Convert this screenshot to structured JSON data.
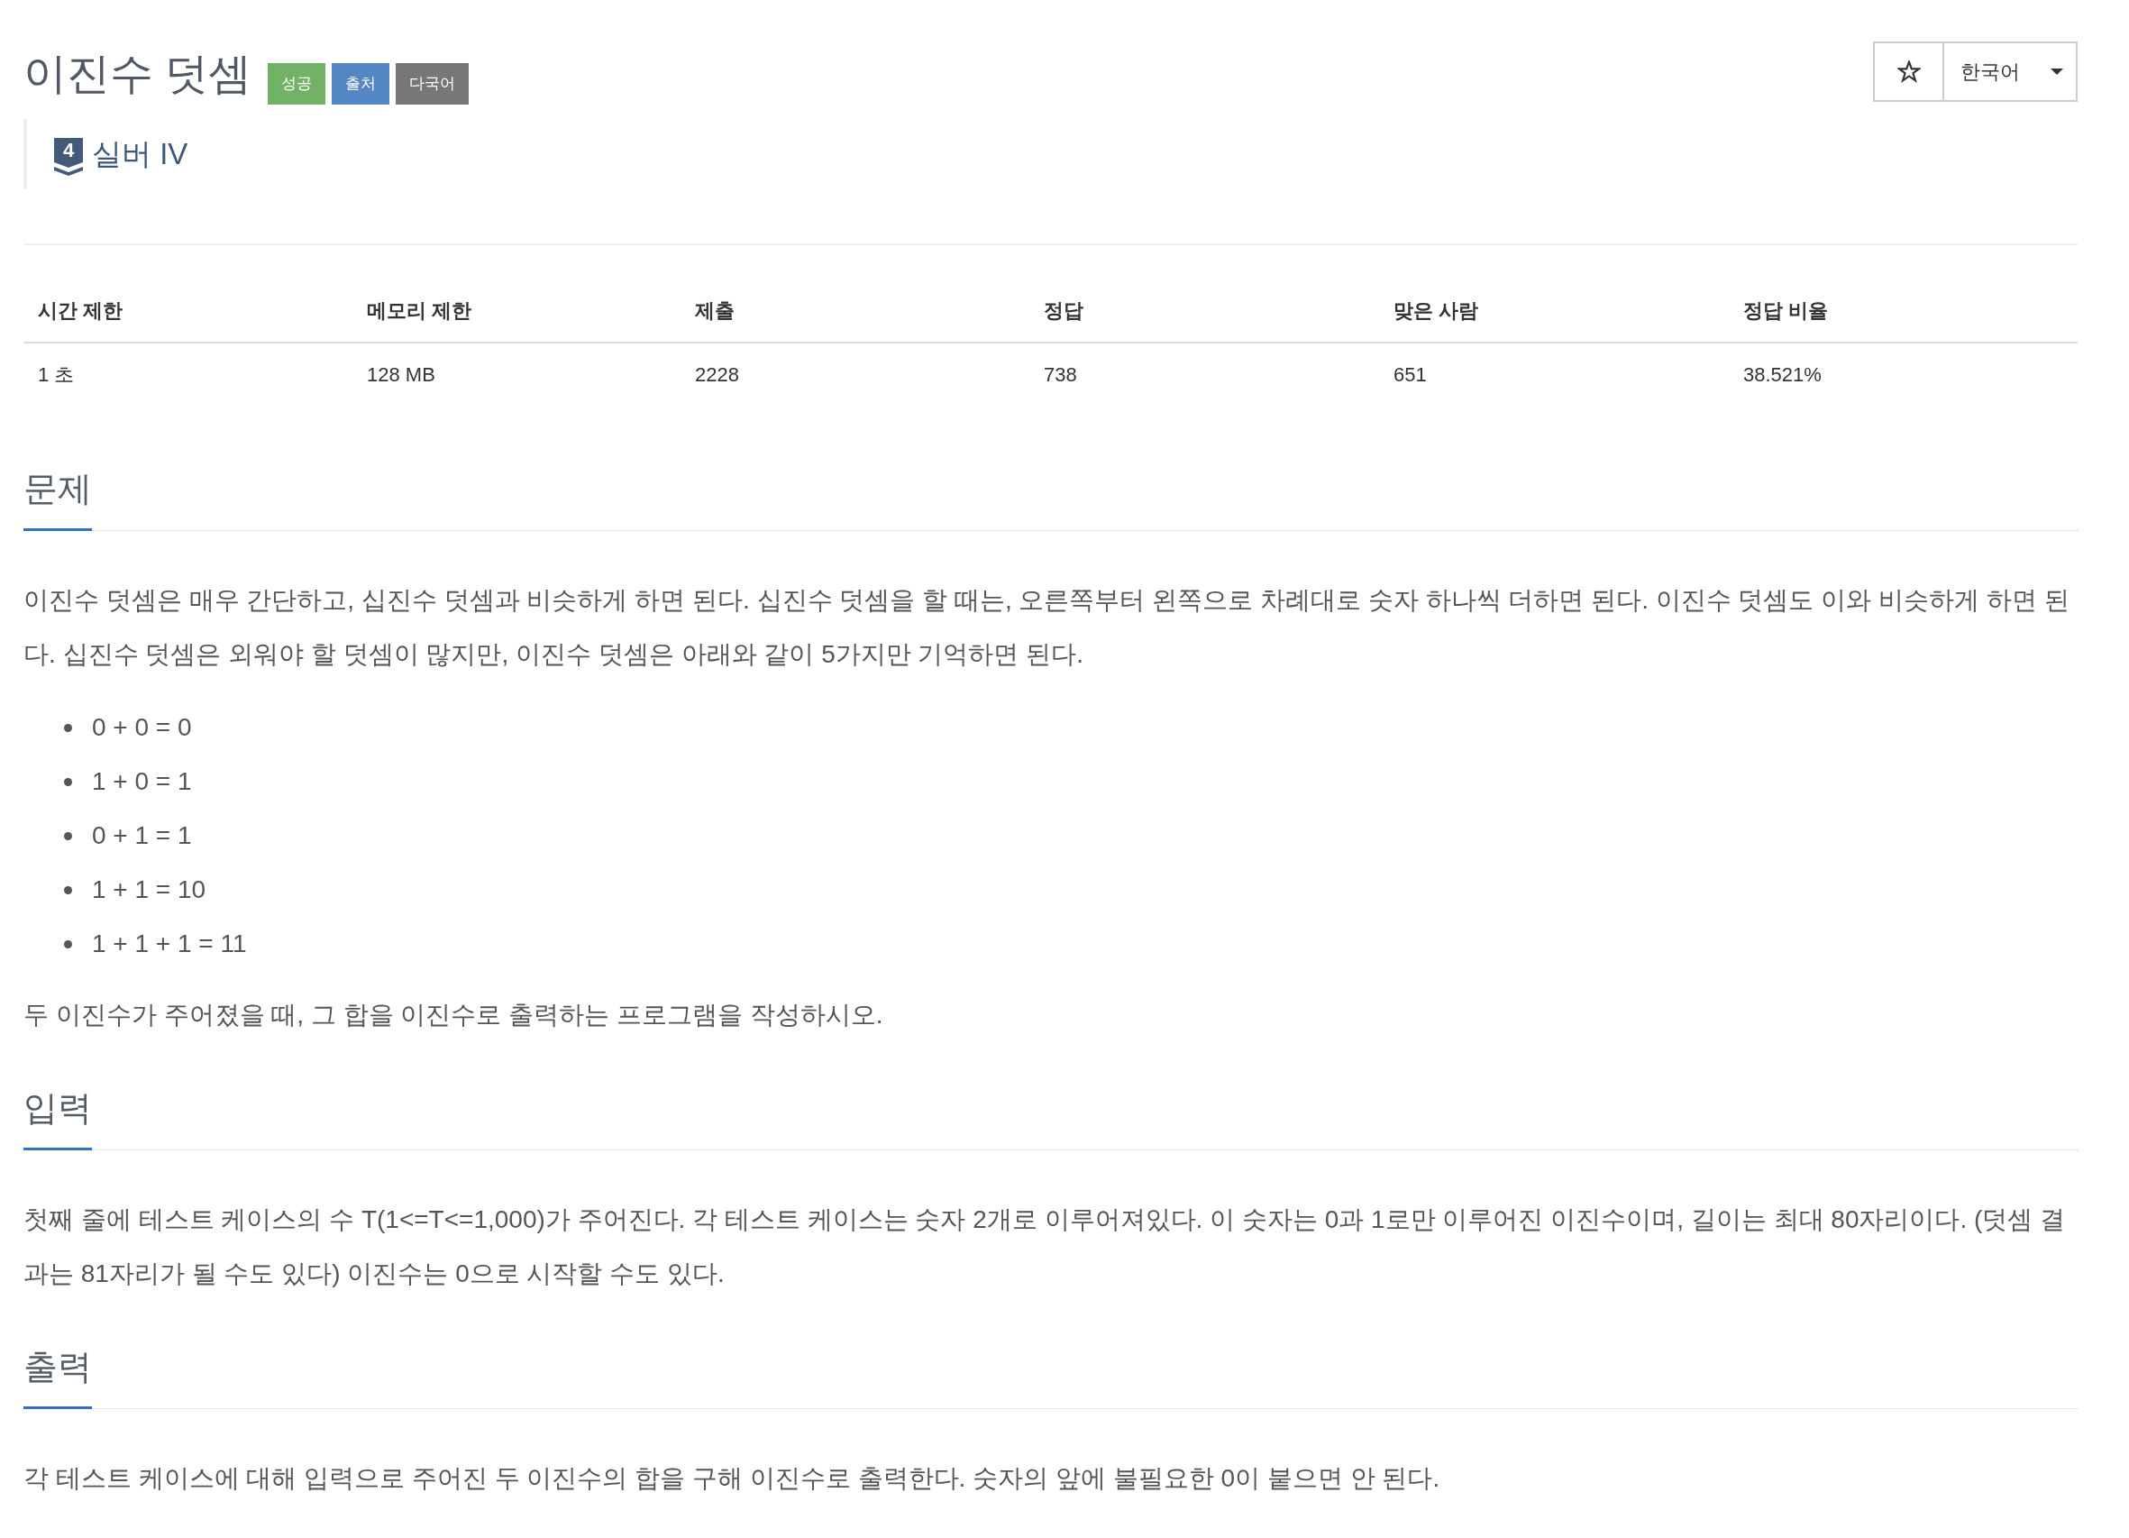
{
  "problem": {
    "title": "이진수 덧셈",
    "badges": [
      {
        "label": "성공",
        "kind": "success"
      },
      {
        "label": "출처",
        "kind": "source"
      },
      {
        "label": "다국어",
        "kind": "multilingual"
      }
    ],
    "tier": {
      "rank": "4",
      "name": "실버 IV"
    }
  },
  "toolbar": {
    "favorite": {
      "starred": false
    },
    "language": {
      "value": "한국어"
    }
  },
  "stats": {
    "columns": [
      "시간 제한",
      "메모리 제한",
      "제출",
      "정답",
      "맞은 사람",
      "정답 비율"
    ],
    "rows": [
      [
        "1 초",
        "128 MB",
        "2228",
        "738",
        "651",
        "38.521%"
      ]
    ]
  },
  "sections": [
    {
      "heading": "문제",
      "content": [
        {
          "kind": "paragraph",
          "text": "이진수 덧셈은 매우 간단하고, 십진수 덧셈과 비슷하게 하면 된다. 십진수 덧셈을 할 때는, 오른쪽부터 왼쪽으로 차례대로 숫자 하나씩 더하면 된다. 이진수 덧셈도 이와 비슷하게 하면 된다. 십진수 덧셈은 외워야 할 덧셈이 많지만, 이진수 덧셈은 아래와 같이 5가지만 기억하면 된다."
        },
        {
          "kind": "list",
          "items": [
            "0 + 0 = 0",
            "1 + 0 = 1",
            "0 + 1 = 1",
            "1 + 1 = 10",
            "1 + 1 + 1 = 11"
          ]
        },
        {
          "kind": "paragraph",
          "text": "두 이진수가 주어졌을 때, 그 합을 이진수로 출력하는 프로그램을 작성하시오."
        }
      ]
    },
    {
      "heading": "입력",
      "content": [
        {
          "kind": "paragraph",
          "text": "첫째 줄에 테스트 케이스의 수 T(1<=T<=1,000)가 주어진다. 각 테스트 케이스는 숫자 2개로 이루어져있다. 이 숫자는 0과 1로만 이루어진 이진수이며, 길이는 최대 80자리이다. (덧셈 결과는 81자리가 될 수도 있다) 이진수는 0으로 시작할 수도 있다."
        }
      ]
    },
    {
      "heading": "출력",
      "content": [
        {
          "kind": "paragraph",
          "text": "각 테스트 케이스에 대해 입력으로 주어진 두 이진수의 합을 구해 이진수로 출력한다. 숫자의 앞에 불필요한 0이 붙으면 안 된다."
        }
      ]
    }
  ]
}
